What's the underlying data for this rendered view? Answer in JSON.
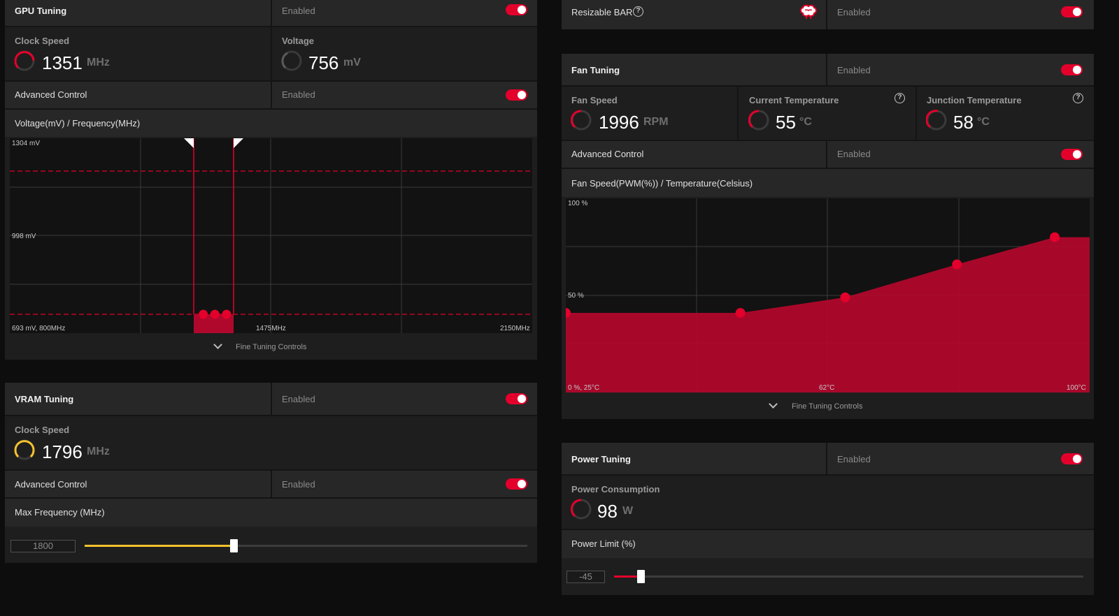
{
  "gpu_tuning": {
    "title": "GPU Tuning",
    "status": "Enabled",
    "clock_speed": {
      "label": "Clock Speed",
      "value": "1351",
      "unit": "MHz"
    },
    "voltage": {
      "label": "Voltage",
      "value": "756",
      "unit": "mV"
    },
    "advanced_control": {
      "label": "Advanced Control",
      "status": "Enabled"
    },
    "curve_title": "Voltage(mV) / Frequency(MHz)",
    "chart_labels": {
      "top": "1304 mV",
      "mid": "998 mV",
      "bottom_left": "693 mV, 800MHz",
      "bottom_mid": "1475MHz",
      "bottom_right": "2150MHz"
    },
    "fine_tuning": "Fine Tuning Controls"
  },
  "vram_tuning": {
    "title": "VRAM Tuning",
    "status": "Enabled",
    "clock_speed": {
      "label": "Clock Speed",
      "value": "1796",
      "unit": "MHz"
    },
    "advanced_control": {
      "label": "Advanced Control",
      "status": "Enabled"
    },
    "max_frequency": {
      "label": "Max Frequency (MHz)",
      "value": "1800",
      "fraction": 0.336
    }
  },
  "resizable_bar": {
    "label": "Resizable BAR",
    "status": "Enabled",
    "icon": "brain-icon"
  },
  "fan_tuning": {
    "title": "Fan Tuning",
    "status": "Enabled",
    "fan_speed": {
      "label": "Fan Speed",
      "value": "1996",
      "unit": "RPM"
    },
    "current_temperature": {
      "label": "Current Temperature",
      "value": "55",
      "unit": "°C"
    },
    "junction_temperature": {
      "label": "Junction Temperature",
      "value": "58",
      "unit": "°C"
    },
    "advanced_control": {
      "label": "Advanced Control",
      "status": "Enabled"
    },
    "curve_title": "Fan Speed(PWM(%)) / Temperature(Celsius)",
    "chart_labels": {
      "top": "100 %",
      "mid": "50 %",
      "bottom_left": "0 %, 25°C",
      "bottom_mid": "62°C",
      "bottom_right": "100°C"
    },
    "fine_tuning": "Fine Tuning Controls"
  },
  "power_tuning": {
    "title": "Power Tuning",
    "status": "Enabled",
    "power_consumption": {
      "label": "Power Consumption",
      "value": "98",
      "unit": "W"
    },
    "power_limit": {
      "label": "Power Limit (%)",
      "value": "-45",
      "fraction": 0.056
    }
  },
  "colors": {
    "accent": "#e3002b",
    "vram_accent": "#f5c12e",
    "panel": "#1e1e1e",
    "row": "#272727"
  },
  "chart_data": [
    {
      "type": "line",
      "xlabel": "Frequency (MHz)",
      "ylabel": "Voltage (mV)",
      "xlim": [
        800,
        2150
      ],
      "ylim": [
        693,
        1304
      ],
      "series": [
        {
          "x": [
            1300,
            1330,
            1360
          ],
          "y": [
            693,
            693,
            693
          ]
        }
      ]
    },
    {
      "type": "area",
      "xlabel": "Temperature (Celsius)",
      "ylabel": "Fan Speed (PWM %)",
      "xlim": [
        25,
        100
      ],
      "ylim": [
        0,
        100
      ],
      "series": [
        {
          "x": [
            25,
            50,
            65,
            81,
            95
          ],
          "y": [
            41,
            41,
            49,
            66,
            80
          ]
        }
      ]
    }
  ]
}
